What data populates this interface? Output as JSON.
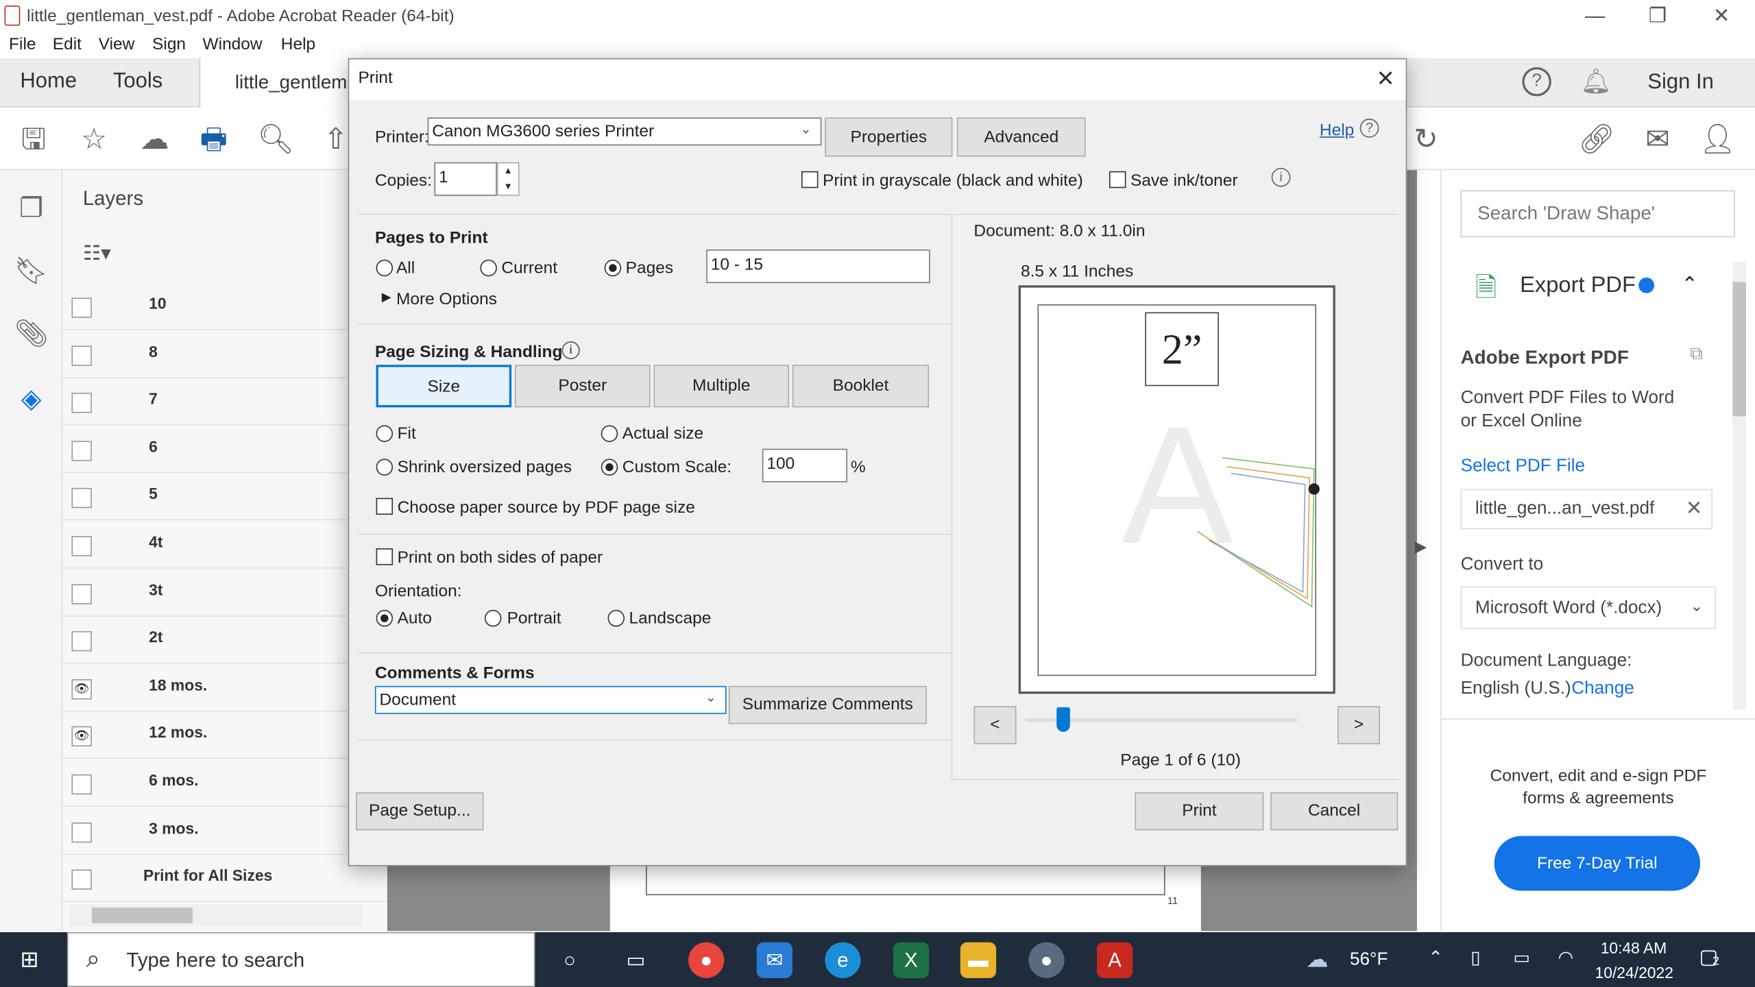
{
  "window": {
    "title": "little_gentleman_vest.pdf - Adobe Acrobat Reader (64-bit)",
    "minimize": "—",
    "restore": "❐",
    "close": "✕"
  },
  "menu": [
    "File",
    "Edit",
    "View",
    "Sign",
    "Window",
    "Help"
  ],
  "nav": {
    "home": "Home",
    "tools": "Tools",
    "doc_tab": "little_gentlem",
    "sign_in": "Sign In"
  },
  "layers": {
    "header": "Layers",
    "rows": [
      {
        "label": "10",
        "eye": false
      },
      {
        "label": "8",
        "eye": false
      },
      {
        "label": "7",
        "eye": false
      },
      {
        "label": "6",
        "eye": false
      },
      {
        "label": "5",
        "eye": false
      },
      {
        "label": "4t",
        "eye": false
      },
      {
        "label": "3t",
        "eye": false
      },
      {
        "label": "2t",
        "eye": false
      },
      {
        "label": "18 mos.",
        "eye": true
      },
      {
        "label": "12 mos.",
        "eye": true
      },
      {
        "label": "6 mos.",
        "eye": false
      },
      {
        "label": "3 mos.",
        "eye": false
      },
      {
        "label": "Print for All Sizes",
        "eye": false
      }
    ]
  },
  "right_panel": {
    "search_placeholder": "Search 'Draw Shape'",
    "export_title": "Export PDF",
    "section_title": "Adobe Export PDF",
    "desc": "Convert PDF Files to Word or Excel Online",
    "select_file": "Select PDF File",
    "file_name": "little_gen...an_vest.pdf",
    "convert_to": "Convert to",
    "format": "Microsoft Word (*.docx)",
    "doc_lang_label": "Document Language:",
    "doc_lang": "English (U.S.)",
    "change": "Change",
    "promo": "Convert, edit and e-sign PDF forms & agreements",
    "trial": "Free 7-Day Trial"
  },
  "print_dialog": {
    "title": "Print",
    "printer_label": "Printer:",
    "printer": "Canon MG3600 series Printer",
    "properties": "Properties",
    "advanced": "Advanced",
    "help": "Help",
    "copies_label": "Copies:",
    "copies": "1",
    "grayscale": "Print in grayscale (black and white)",
    "save_ink": "Save ink/toner",
    "pages_to_print": "Pages to Print",
    "all": "All",
    "current": "Current",
    "pages": "Pages",
    "pages_range": "10 - 15",
    "more_options": "More Options",
    "sizing_title": "Page Sizing & Handling",
    "size": "Size",
    "poster": "Poster",
    "multiple": "Multiple",
    "booklet": "Booklet",
    "fit": "Fit",
    "actual_size": "Actual size",
    "shrink": "Shrink oversized pages",
    "custom_scale": "Custom Scale:",
    "scale_value": "100",
    "percent": "%",
    "paper_source": "Choose paper source by PDF page size",
    "both_sides": "Print on both sides of paper",
    "orientation_label": "Orientation:",
    "auto": "Auto",
    "portrait": "Portrait",
    "landscape": "Landscape",
    "comments_title": "Comments & Forms",
    "comments_value": "Document",
    "summarize": "Summarize Comments",
    "document_size": "Document: 8.0 x 11.0in",
    "paper_size": "8.5 x 11 Inches",
    "preview_heading": "2”",
    "prev": "<",
    "next": ">",
    "page_info": "Page 1 of 6 (10)",
    "page_setup": "Page Setup...",
    "print": "Print",
    "cancel": "Cancel"
  },
  "taskbar": {
    "search_placeholder": "Type here to search",
    "weather": "56°F",
    "time": "10:48 AM",
    "date": "10/24/2022",
    "notif_count": "2"
  },
  "colors": {
    "accent": "#1473e6",
    "print_icon": "#1a5ea8",
    "taskbar": "#1f2c3c"
  }
}
